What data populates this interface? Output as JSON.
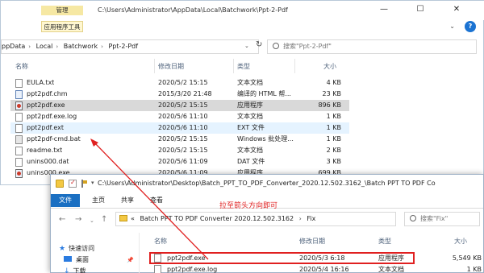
{
  "back": {
    "ctx_tab": "管理",
    "ctx_subtab": "应用程序工具",
    "title": "C:\\Users\\Administrator\\AppData\\Local\\Batchwork\\Ppt-2-Pdf",
    "win_minimize": "—",
    "win_maximize": "☐",
    "win_close": "✕",
    "breadcrumb": [
      "ppData",
      "Local",
      "Batchwork",
      "Ppt-2-Pdf"
    ],
    "search_placeholder": "搜索\"Ppt-2-Pdf\"",
    "columns": [
      "名称",
      "修改日期",
      "类型",
      "大小"
    ],
    "files": [
      {
        "name": "EULA.txt",
        "date": "2020/5/2 15:15",
        "type": "文本文档",
        "size": "4 KB",
        "icon": "txt"
      },
      {
        "name": "ppt2pdf.chm",
        "date": "2015/3/20 21:48",
        "type": "编译的 HTML 帮...",
        "size": "23 KB",
        "icon": "chm"
      },
      {
        "name": "ppt2pdf.exe",
        "date": "2020/5/2 15:15",
        "type": "应用程序",
        "size": "896 KB",
        "icon": "exe"
      },
      {
        "name": "ppt2pdf.exe.log",
        "date": "2020/5/6 11:10",
        "type": "文本文档",
        "size": "1 KB",
        "icon": "txt"
      },
      {
        "name": "ppt2pdf.ext",
        "date": "2020/5/6 11:10",
        "type": "EXT 文件",
        "size": "1 KB",
        "icon": "txt"
      },
      {
        "name": "ppt2pdf-cmd.bat",
        "date": "2020/5/2 15:15",
        "type": "Windows 批处理...",
        "size": "1 KB",
        "icon": "bat"
      },
      {
        "name": "readme.txt",
        "date": "2020/5/2 15:15",
        "type": "文本文档",
        "size": "2 KB",
        "icon": "txt"
      },
      {
        "name": "unins000.dat",
        "date": "2020/5/6 11:09",
        "type": "DAT 文件",
        "size": "3 KB",
        "icon": "txt"
      },
      {
        "name": "unins000.exe",
        "date": "2020/5/6 11:09",
        "type": "应用程序",
        "size": "699 KB",
        "icon": "exe"
      }
    ]
  },
  "front": {
    "title": "C:\\Users\\Administrator\\Desktop\\Batch_PPT_TO_PDF_Converter_2020.12.502.3162_\\Batch PPT TO PDF Co",
    "tabs": [
      "文件",
      "主页",
      "共享",
      "查看"
    ],
    "nav_back": "←",
    "nav_forward": "→",
    "nav_up": "↑",
    "breadcrumb_prefix": "«",
    "breadcrumb": [
      "Batch PPT TO PDF Converter 2020.12.502.3162",
      "Fix"
    ],
    "search_placeholder": "搜索\"Fix\"",
    "nav_pane": [
      "快速访问",
      "桌面",
      "下载"
    ],
    "columns": [
      "名称",
      "修改日期",
      "类型",
      "大小"
    ],
    "files": [
      {
        "name": "ppt2pdf.exe",
        "date": "2020/5/3 6:18",
        "type": "应用程序",
        "size": "5,549 KB"
      },
      {
        "name": "ppt2pdf.exe.log",
        "date": "2020/5/4 16:16",
        "type": "文本文档",
        "size": "1 KB"
      }
    ]
  },
  "annotation": "拉至箭头方向即可",
  "colors": {
    "accent": "#1a6fc2",
    "annotation": "#e02020",
    "selected_row": "#d9d9d9",
    "hover_row": "#e5f3ff"
  }
}
